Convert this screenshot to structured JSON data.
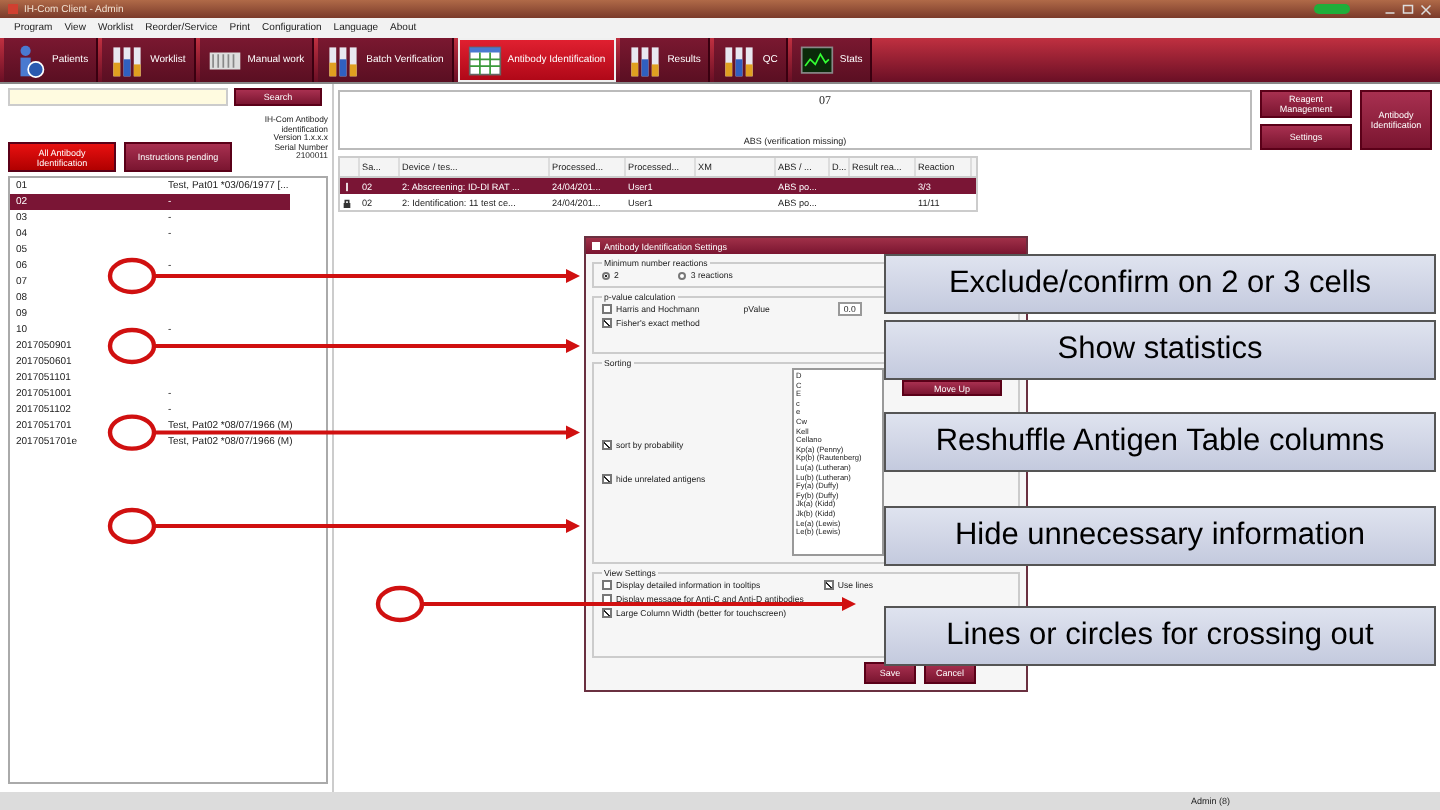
{
  "window": {
    "title": "IH-Com Client - Admin"
  },
  "menu": [
    "Program",
    "View",
    "Worklist",
    "Reorder/Service",
    "Print",
    "Configuration",
    "Language",
    "About"
  ],
  "toolbar": [
    {
      "label": "Patients",
      "kind": "person",
      "selected": false
    },
    {
      "label": "Worklist",
      "kind": "tubes",
      "selected": false
    },
    {
      "label": "Manual work",
      "kind": "rack",
      "selected": false
    },
    {
      "label": "Batch Verification",
      "kind": "tubes",
      "selected": false
    },
    {
      "label": "Antibody Identification",
      "kind": "grid",
      "selected": true
    },
    {
      "label": "Results",
      "kind": "tubes",
      "selected": false
    },
    {
      "label": "QC",
      "kind": "tubes",
      "selected": false
    },
    {
      "label": "Stats",
      "kind": "monitor",
      "selected": false
    }
  ],
  "search": {
    "button": "Search"
  },
  "app_info": [
    "IH-Com Antibody",
    "identification",
    "Version 1.x.x.x",
    "Serial Number",
    "2100011"
  ],
  "filters": [
    {
      "label": "All Antibody Identification",
      "selected": true
    },
    {
      "label": "Instructions pending",
      "selected": false
    }
  ],
  "samples": [
    {
      "id": "01",
      "text": "Test, Pat01 *03/06/1977 [...",
      "selected": false
    },
    {
      "id": "02",
      "text": "-",
      "selected": true
    },
    {
      "id": "03",
      "text": "-",
      "selected": false
    },
    {
      "id": "04",
      "text": "-",
      "selected": false
    },
    {
      "id": "05",
      "selected": false
    },
    {
      "id": "06",
      "text": "-",
      "selected": false
    },
    {
      "id": "07",
      "selected": false
    },
    {
      "id": "08",
      "selected": false
    },
    {
      "id": "09",
      "selected": false
    },
    {
      "id": "10",
      "text": "-",
      "selected": false
    },
    {
      "id": "2017050901",
      "selected": false
    },
    {
      "id": "2017050601",
      "selected": false
    },
    {
      "id": "2017051101",
      "selected": false
    },
    {
      "id": "2017051001",
      "text": "-",
      "selected": false
    },
    {
      "id": "2017051102",
      "text": "-",
      "selected": false
    },
    {
      "id": "2017051701",
      "text": "Test, Pat02 *08/07/1966 (M)",
      "selected": false
    },
    {
      "id": "2017051701e",
      "text": "Test, Pat02 *08/07/1966 (M)",
      "selected": false
    }
  ],
  "header": {
    "sample": "07",
    "status": "ABS (verification missing)"
  },
  "side_buttons": [
    "Reagent Management",
    "Settings"
  ],
  "main_button": "Antibody Identification",
  "table": {
    "columns": [
      "Sa...",
      "Device / tes...",
      "Processed...",
      "Processed...",
      "XM",
      "ABS / ...",
      "D...",
      "Result rea...",
      "Reaction"
    ],
    "rows": [
      {
        "kind": "marker",
        "selected": true,
        "cells": [
          "02",
          "2: Abscreening: ID-DI RAT ...",
          "24/04/201...",
          "User1",
          "",
          "ABS po...",
          "",
          "",
          "3/3"
        ]
      },
      {
        "kind": "lock",
        "selected": false,
        "cells": [
          "02",
          "2: Identification: 11 test ce...",
          "24/04/201...",
          "User1",
          "",
          "ABS po...",
          "",
          "",
          "11/11"
        ]
      }
    ]
  },
  "dialog": {
    "title": "Antibody Identification Settings",
    "reactions": {
      "legend": "Minimum number reactions",
      "options": [
        {
          "label": "2",
          "selected": true
        },
        {
          "label": "3 reactions",
          "selected": false
        }
      ]
    },
    "pvalue": {
      "legend": "p-value calculation",
      "options": [
        {
          "label": "Harris and Hochmann",
          "checked": false
        },
        {
          "label": "Fisher's exact method",
          "checked": true
        }
      ],
      "field_label": "pValue",
      "field_value": "0.0"
    },
    "sorting": {
      "legend": "Sorting",
      "options": [
        {
          "label": "sort by probability",
          "checked": true
        },
        {
          "label": "hide unrelated antigens",
          "checked": true
        }
      ],
      "antigens": [
        "D",
        "C",
        "E",
        "c",
        "e",
        "Cw",
        "Kell",
        "Cellano",
        "Kp(a) (Penny)",
        "Kp(b) (Rautenberg)",
        "Lu(a) (Lutheran)",
        "Lu(b) (Lutheran)",
        "Fy(a) (Duffy)",
        "Fy(b) (Duffy)",
        "Jk(a) (Kidd)",
        "Jk(b) (Kidd)",
        "Le(a) (Lewis)",
        "Le(b) (Lewis)"
      ],
      "button": "Move Up"
    },
    "view": {
      "legend": "View Settings",
      "options": [
        {
          "label": "Display detailed information in tooltips",
          "checked": false
        },
        {
          "label": "Display message for Anti-C and Anti-D antibodies",
          "checked": false
        },
        {
          "label": "Large Column Width (better for touchscreen)",
          "checked": true
        }
      ],
      "lines": {
        "label": "Use lines",
        "checked": true
      }
    },
    "buttons": [
      "Save",
      "Cancel"
    ]
  },
  "callouts": [
    "Exclude/confirm on 2 or 3 cells",
    "Show statistics",
    "Reshuffle Antigen Table columns",
    "Hide unnecessary information",
    "Lines or circles for crossing out"
  ],
  "status_bar": "Admin (8)"
}
